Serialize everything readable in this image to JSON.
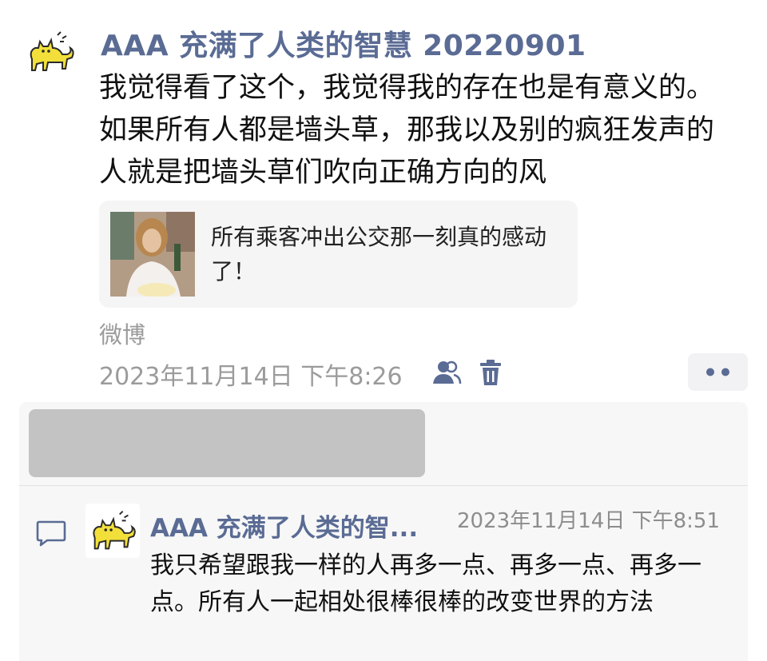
{
  "post": {
    "author": "AAA 充满了人类的智慧 20220901",
    "text": "我觉得看了这个，我觉得我的存在也是有意义的。如果所有人都是墙头草，那我以及别的疯狂发声的人就是把墙头草们吹向正确方向的风",
    "shared": {
      "title": "所有乘客冲出公交那一刻真的感动了！"
    },
    "source": "微博",
    "timestamp": "2023年11月14日 下午8:26",
    "icons": {
      "avatar": "cat-avatar-icon",
      "visibility": "person-icon",
      "delete": "trash-icon",
      "more": "more-dots-icon"
    },
    "colors": {
      "author": "#5a6b94",
      "meta": "#9b9b9b",
      "card_bg": "#f5f5f6"
    }
  },
  "comments": [
    {
      "author": "AAA 充满了人类的智...",
      "time": "2023年11月14日 下午8:51",
      "text": "我只希望跟我一样的人再多一点、再多一点、再多一点。所有人一起相处很棒很棒的改变世界的方法"
    }
  ],
  "comment_icon": "comment-bubble-icon"
}
